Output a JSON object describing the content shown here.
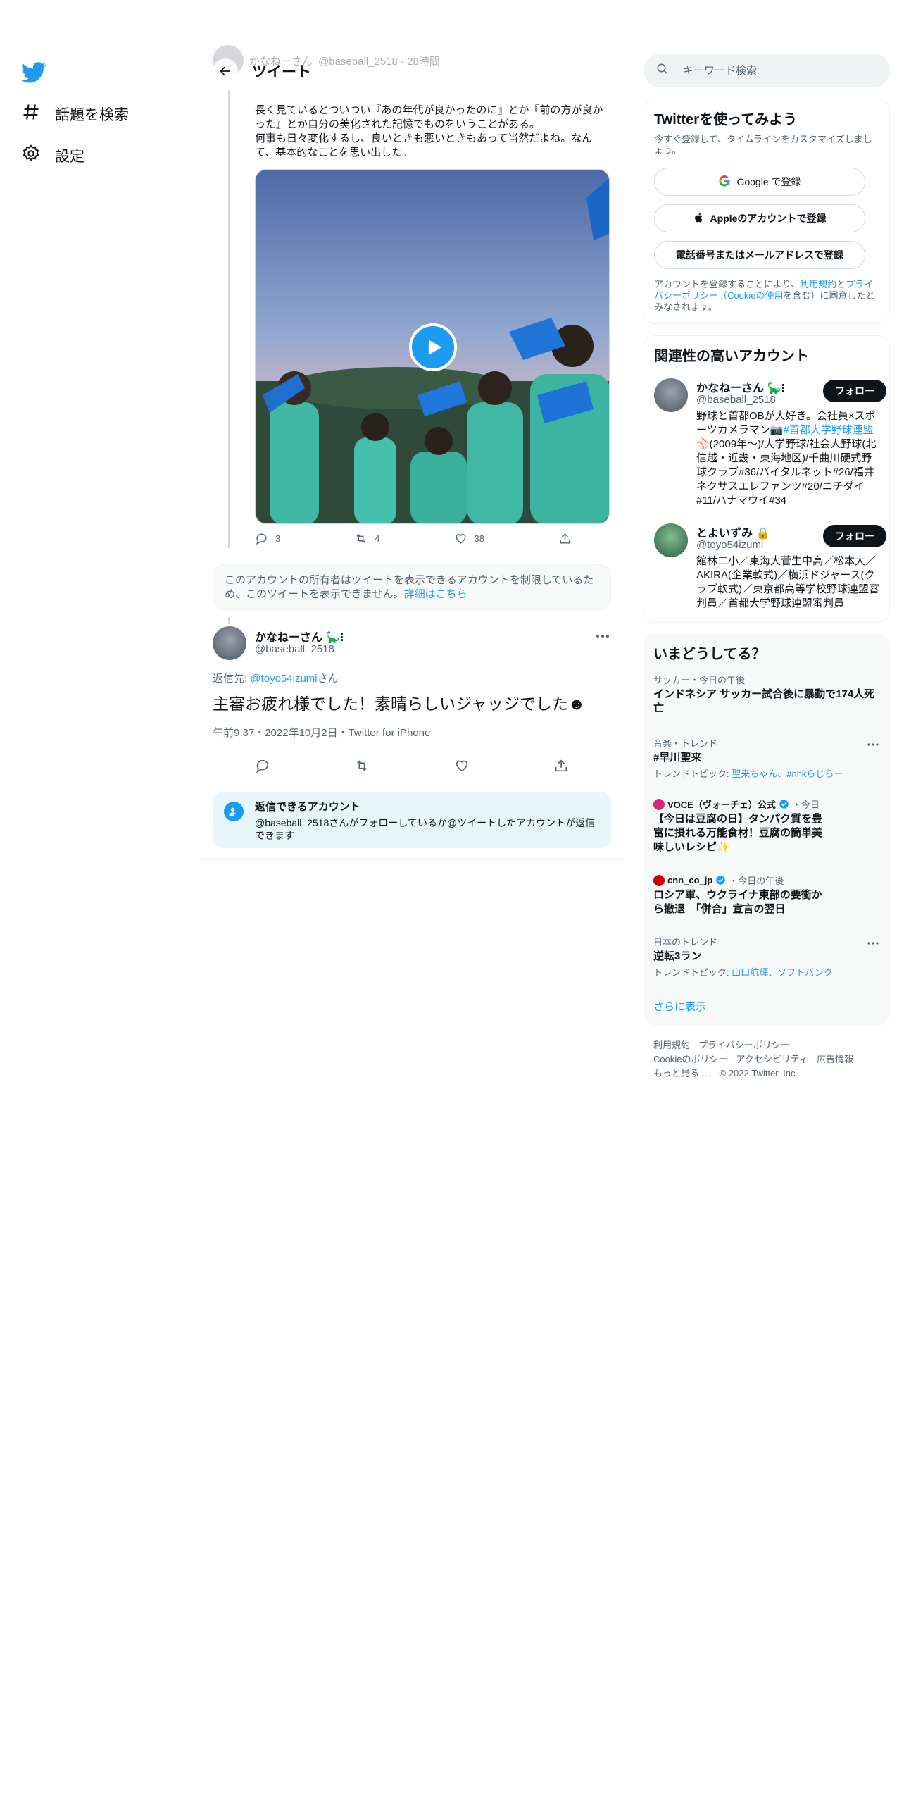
{
  "nav": {
    "explore_label": "話題を検索",
    "settings_label": "設定"
  },
  "header": {
    "title": "ツイート"
  },
  "prev_tweet": {
    "author_faded": "かなねーさん",
    "handle_faded": "@baseball_2518 · 28時間",
    "body_line1": "長く見ているとついつい『あの年代が良かったのに』とか『前の方が良かった』とか自分の美化された記憶でものをいうことがある。",
    "body_line2": "何事も日々変化するし、良いときも悪いときもあって当然だよね。なんて、基本的なことを思い出した。",
    "replies": "3",
    "retweets": "4",
    "likes": "38"
  },
  "restricted": {
    "text": "このアカウントの所有者はツイートを表示できるアカウントを制限しているため、このツイートを表示できません。",
    "link": "詳細はこちら"
  },
  "main_tweet": {
    "author": "かなねーさん",
    "handle": "@baseball_2518",
    "reply_prefix": "返信先: ",
    "reply_mention": "@toyo54izumi",
    "reply_suffix": "さん",
    "text": "主審お疲れ様でした！素晴らしいジャッジでした☻",
    "meta": "午前9:37・2022年10月2日・Twitter for iPhone"
  },
  "can_reply": {
    "title": "返信できるアカウント",
    "desc": "@baseball_2518さんがフォローしているか@ツイートしたアカウントが返信できます"
  },
  "search": {
    "placeholder": "キーワード検索"
  },
  "signup": {
    "title": "Twitterを使ってみよう",
    "sub": "今すぐ登録して、タイムラインをカスタマイズしましょう。",
    "google": "Google で登録",
    "apple": "Appleのアカウントで登録",
    "phone": "電話番号またはメールアドレスで登録",
    "legal_a": "アカウントを登録することにより、",
    "legal_terms": "利用規約",
    "legal_b": "と",
    "legal_privacy": "プライバシーポリシー（Cookieの使用",
    "legal_c": "を含む）に同意したとみなされます。"
  },
  "related": {
    "title": "関連性の高いアカウント",
    "follow_label": "フォロー",
    "accounts": [
      {
        "name": "かなねーさん",
        "handle": "@baseball_2518",
        "bio_a": "野球と首都OBが大好き。会社員×スポーツカメラマン📷",
        "bio_link": "#首都大学野球連盟",
        "bio_b": "⚾(2009年～)/大学野球/社会人野球(北信越・近畿・東海地区)/千曲川硬式野球クラブ#36/バイタルネット#26/福井ネクサスエレファンツ#20/ニチダイ#11/ハナマウイ#34"
      },
      {
        "name": "とよいずみ",
        "handle": "@toyo54izumi",
        "bio_a": "館林二小／東海大菅生中高／松本大／AKIRA(企業軟式)／横浜ドジャース(クラブ軟式)／東京都高等学校野球連盟審判員／首都大学野球連盟審判員",
        "bio_link": "",
        "bio_b": ""
      }
    ]
  },
  "trends": {
    "title": "いまどうしてる？",
    "items": [
      {
        "ctx": "サッカー・今日の午後",
        "title": "インドネシア サッカー試合後に暴動で174人死亡",
        "topic_prefix": "",
        "topic": ""
      },
      {
        "ctx": "音楽・トレンド",
        "title": "#早川聖来",
        "topic_prefix": "トレンドトピック: ",
        "topic": "聖来ちゃん、#nhkらじらー"
      },
      {
        "src": "VOCE（ヴォーチェ）公式",
        "when": "・今日",
        "title": "【今日は豆腐の日】タンパク質を豊富に摂れる万能食材！豆腐の簡単美味しいレシピ✨"
      },
      {
        "src": "cnn_co_jp",
        "when": "・今日の午後",
        "title": "ロシア軍、ウクライナ東部の要衝から撤退　「併合」宣言の翌日"
      },
      {
        "ctx": "日本のトレンド",
        "title": "逆転3ラン",
        "topic_prefix": "トレンドトピック: ",
        "topic": "山口航輝、ソフトバンク"
      }
    ],
    "show_more": "さらに表示"
  },
  "footer": {
    "links": [
      "利用規約",
      "プライバシーポリシー",
      "Cookieのポリシー",
      "アクセシビリティ",
      "広告情報",
      "もっと見る …",
      "© 2022 Twitter, Inc."
    ]
  },
  "colors": {
    "accent": "#1d9bf0",
    "text": "#0f1419",
    "muted": "#536471"
  }
}
